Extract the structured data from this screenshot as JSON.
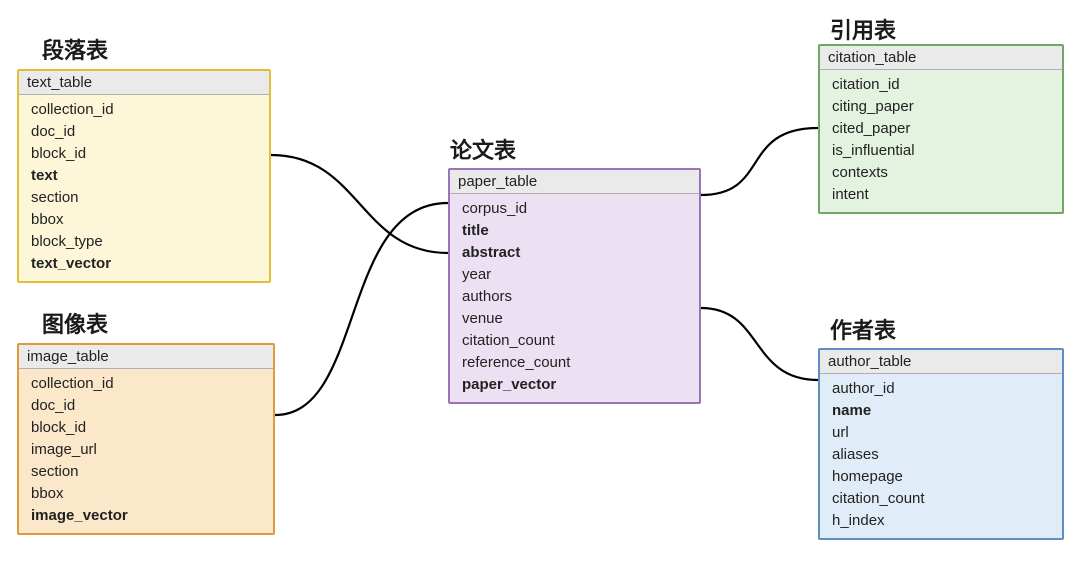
{
  "titles": {
    "text_table": "段落表",
    "image_table": "图像表",
    "paper_table": "论文表",
    "citation_table": "引用表",
    "author_table": "作者表"
  },
  "tables": {
    "text": {
      "name": "text_table",
      "fields": [
        {
          "label": "collection_id",
          "bold": false
        },
        {
          "label": "doc_id",
          "bold": false
        },
        {
          "label": "block_id",
          "bold": false
        },
        {
          "label": "text",
          "bold": true
        },
        {
          "label": "section",
          "bold": false
        },
        {
          "label": "bbox",
          "bold": false
        },
        {
          "label": "block_type",
          "bold": false
        },
        {
          "label": "text_vector",
          "bold": true
        }
      ]
    },
    "image": {
      "name": "image_table",
      "fields": [
        {
          "label": "collection_id",
          "bold": false
        },
        {
          "label": "doc_id",
          "bold": false
        },
        {
          "label": "block_id",
          "bold": false
        },
        {
          "label": "image_url",
          "bold": false
        },
        {
          "label": "section",
          "bold": false
        },
        {
          "label": "bbox",
          "bold": false
        },
        {
          "label": "image_vector",
          "bold": true
        }
      ]
    },
    "paper": {
      "name": "paper_table",
      "fields": [
        {
          "label": "corpus_id",
          "bold": false
        },
        {
          "label": "title",
          "bold": true
        },
        {
          "label": "abstract",
          "bold": true
        },
        {
          "label": "year",
          "bold": false
        },
        {
          "label": "authors",
          "bold": false
        },
        {
          "label": "venue",
          "bold": false
        },
        {
          "label": "citation_count",
          "bold": false
        },
        {
          "label": "reference_count",
          "bold": false
        },
        {
          "label": "paper_vector",
          "bold": true
        }
      ]
    },
    "citation": {
      "name": "citation_table",
      "fields": [
        {
          "label": "citation_id",
          "bold": false
        },
        {
          "label": "citing_paper",
          "bold": false
        },
        {
          "label": "cited_paper",
          "bold": false
        },
        {
          "label": "is_influential",
          "bold": false
        },
        {
          "label": "contexts",
          "bold": false
        },
        {
          "label": "intent",
          "bold": false
        }
      ]
    },
    "author": {
      "name": "author_table",
      "fields": [
        {
          "label": "author_id",
          "bold": false
        },
        {
          "label": "name",
          "bold": true
        },
        {
          "label": "url",
          "bold": false
        },
        {
          "label": "aliases",
          "bold": false
        },
        {
          "label": "homepage",
          "bold": false
        },
        {
          "label": "citation_count",
          "bold": false
        },
        {
          "label": "h_index",
          "bold": false
        }
      ]
    }
  }
}
